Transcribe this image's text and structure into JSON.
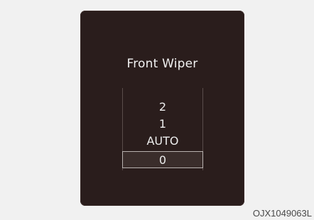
{
  "screen": {
    "title": "Front Wiper",
    "options": [
      "2",
      "1",
      "AUTO",
      "0"
    ],
    "selected": "0"
  },
  "caption": {
    "code": "OJX1049063L"
  }
}
